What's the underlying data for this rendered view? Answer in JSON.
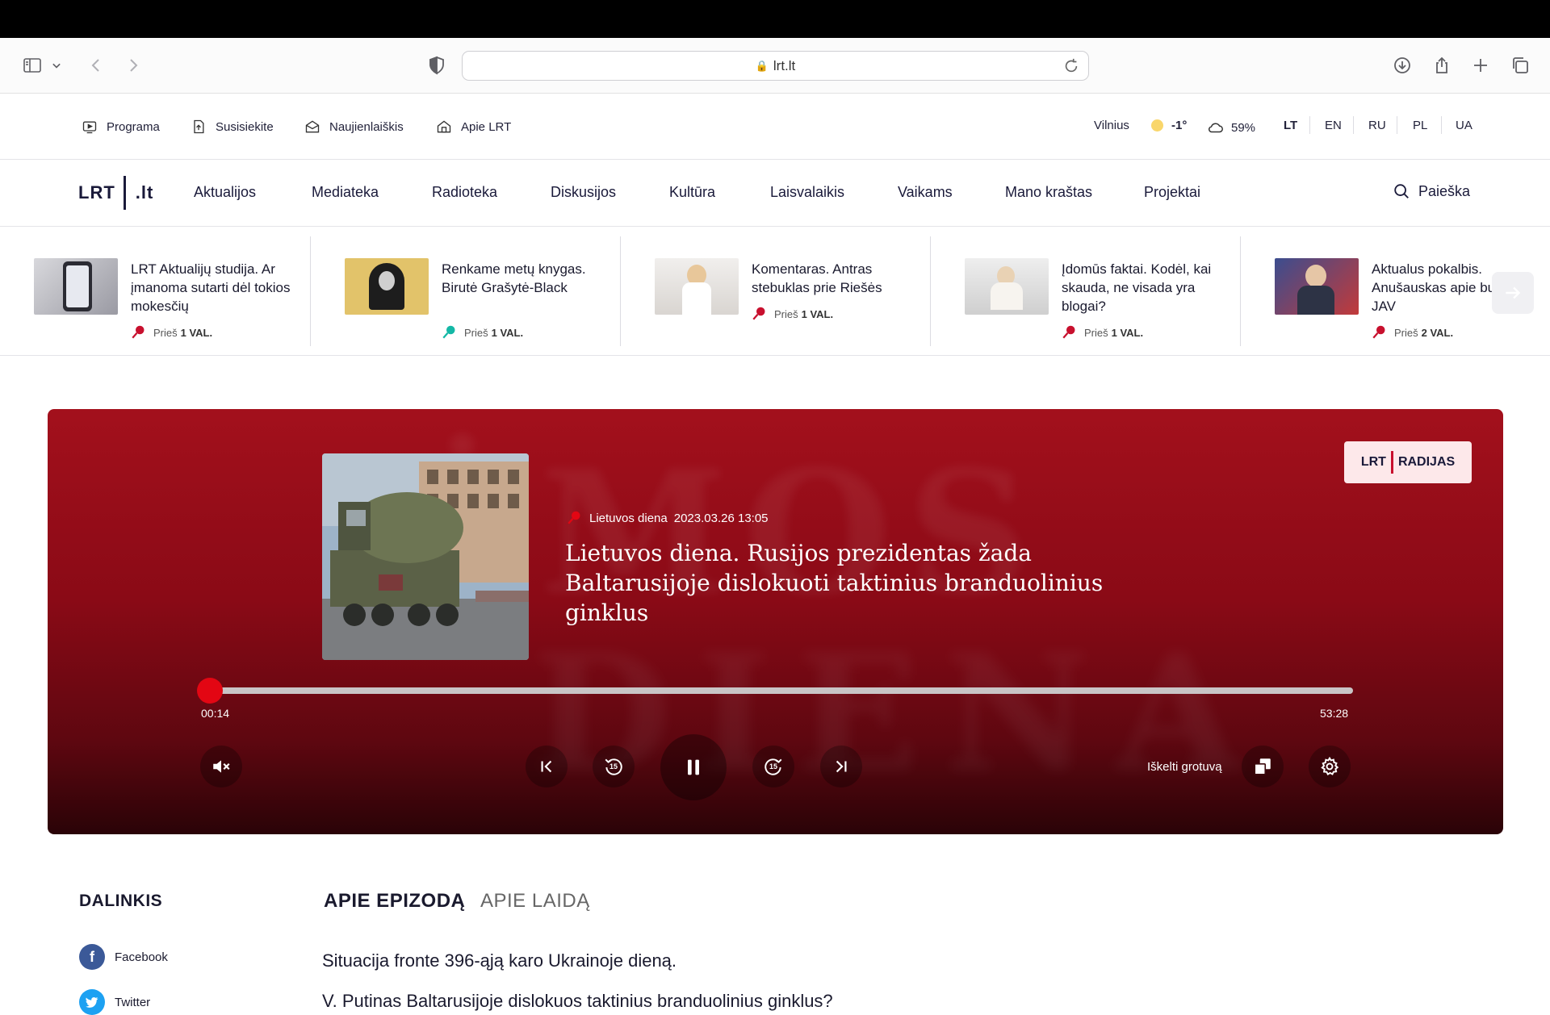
{
  "browser": {
    "url": "lrt.lt"
  },
  "util": {
    "items": [
      {
        "label": "Programa",
        "icon": "tv-icon"
      },
      {
        "label": "Susisiekite",
        "icon": "upload-doc-icon"
      },
      {
        "label": "Naujienlaiškis",
        "icon": "envelope-icon"
      },
      {
        "label": "Apie LRT",
        "icon": "home-icon"
      }
    ],
    "weather": {
      "city": "Vilnius",
      "temp": "-1°",
      "humidity": "59%"
    },
    "languages": [
      "LT",
      "EN",
      "RU",
      "PL",
      "UA"
    ],
    "active_language": "LT"
  },
  "nav": {
    "logo_left": "LRT",
    "logo_right": ".lt",
    "items": [
      "Aktualijos",
      "Mediateka",
      "Radioteka",
      "Diskusijos",
      "Kultūra",
      "Laisvalaikis",
      "Vaikams",
      "Mano kraštas",
      "Projektai"
    ],
    "search_label": "Paieška"
  },
  "ticker": [
    {
      "title": "LRT Aktualijų studija. Ar įmanoma sutarti dėl tokios mokesčių",
      "ago": "Prieš",
      "age": "1 VAL.",
      "mic_color": "#c8102e"
    },
    {
      "title": "Renkame metų knygas. Birutė Grašytė-Black",
      "ago": "Prieš",
      "age": "1 VAL.",
      "mic_color": "#14b8a6"
    },
    {
      "title": "Komentaras. Antras stebuklas prie Riešės",
      "ago": "Prieš",
      "age": "1 VAL.",
      "mic_color": "#c8102e"
    },
    {
      "title": "Įdomūs faktai. Kodėl, kai skauda, ne visada yra blogai?",
      "ago": "Prieš",
      "age": "1 VAL.",
      "mic_color": "#c8102e"
    },
    {
      "title": "Aktualus pokalbis. Anušauskas apie buvusio JAV",
      "ago": "Prieš",
      "age": "2 VAL.",
      "mic_color": "#c8102e"
    }
  ],
  "player": {
    "badge_left": "LRT",
    "badge_right": "RADIJAS",
    "show": "Lietuvos diena",
    "date": "2023.03.26 13:05",
    "title": "Lietuvos diena. Rusijos prezidentas žada Baltarusijoje dislokuoti taktinius branduolinius ginklus",
    "elapsed": "00:14",
    "duration": "53:28",
    "progress_fraction": 0.0044,
    "popout_label": "Iškelti grotuvą",
    "skip_back": "15",
    "skip_forward": "15"
  },
  "share": {
    "title": "DALINKIS",
    "items": [
      {
        "label": "Facebook",
        "color": "#3b5998"
      },
      {
        "label": "Twitter",
        "color": "#1da1f2"
      }
    ]
  },
  "tabs": [
    "APIE EPIZODĄ",
    "APIE LAIDĄ"
  ],
  "content": {
    "p1": "Situacija fronte 396-ąją karo Ukrainoje dieną.",
    "p2": "V. Putinas Baltarusijoje dislokuos taktinius branduolinius ginklus?"
  }
}
